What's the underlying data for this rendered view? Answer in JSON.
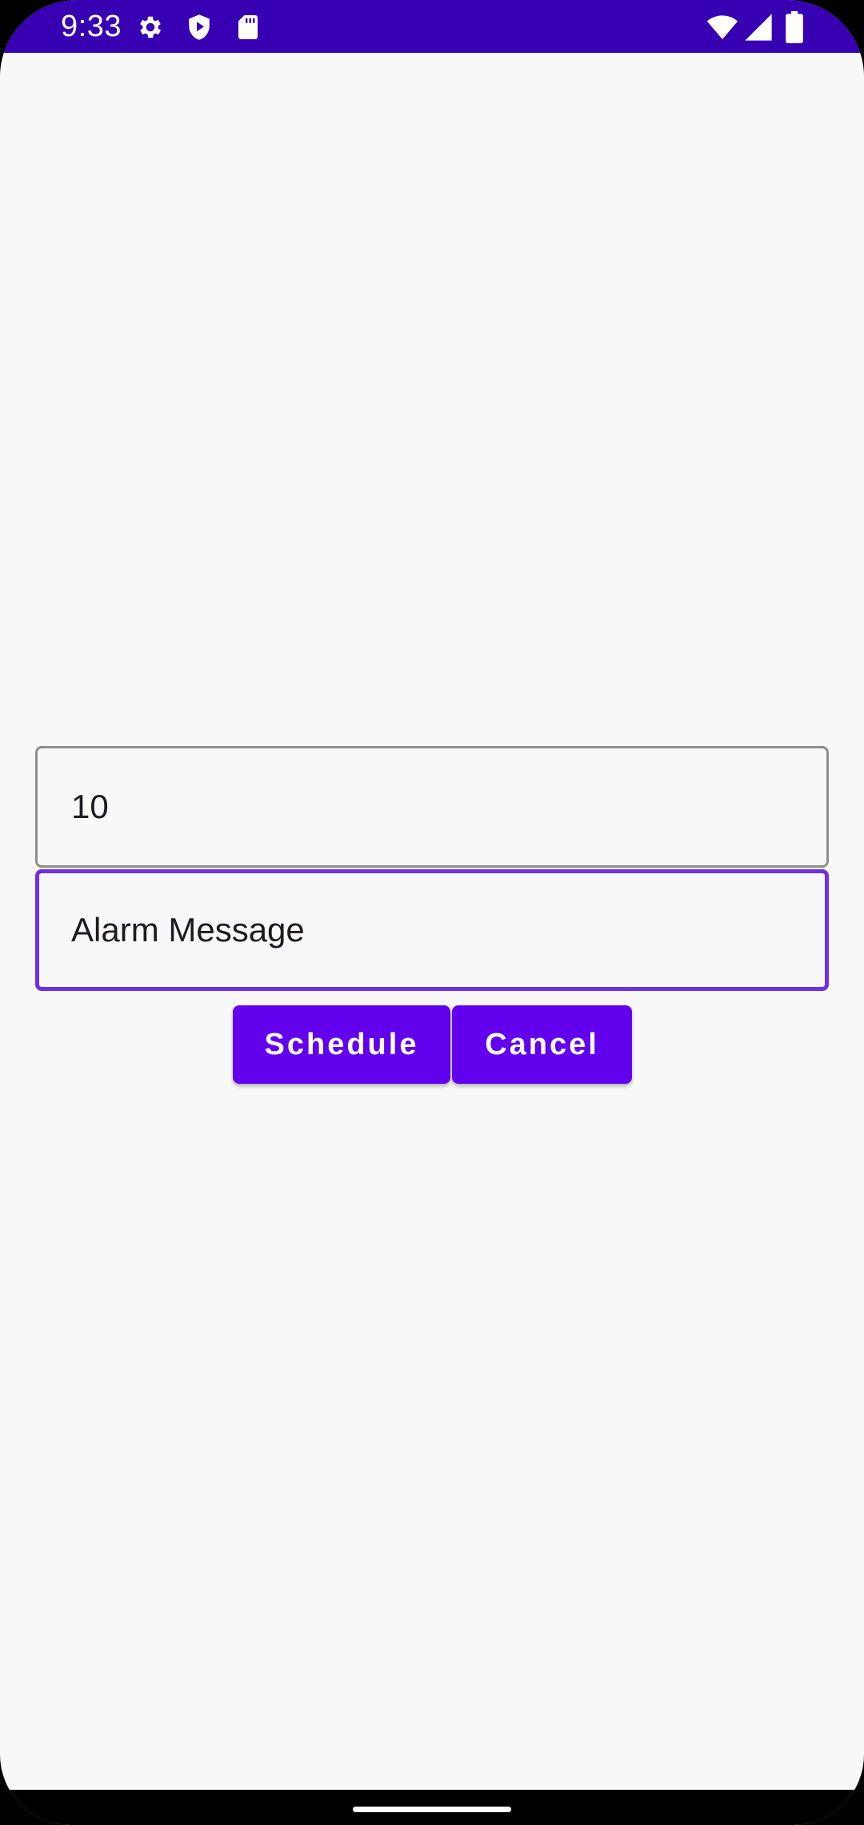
{
  "status_bar": {
    "time": "9:33",
    "background_color": "#3700b3",
    "left_icons": [
      "gear-icon",
      "shield-play-icon",
      "sd-card-icon"
    ],
    "right_icons": [
      "wifi-icon",
      "cellular-signal-icon",
      "battery-icon"
    ]
  },
  "form": {
    "delay_field": {
      "value": "10"
    },
    "message_field": {
      "value": "Alarm Message",
      "focused": true,
      "focus_color": "#6f2fe6"
    }
  },
  "actions": {
    "schedule_label": "Schedule",
    "cancel_label": "Cancel",
    "button_color": "#6200ee"
  }
}
